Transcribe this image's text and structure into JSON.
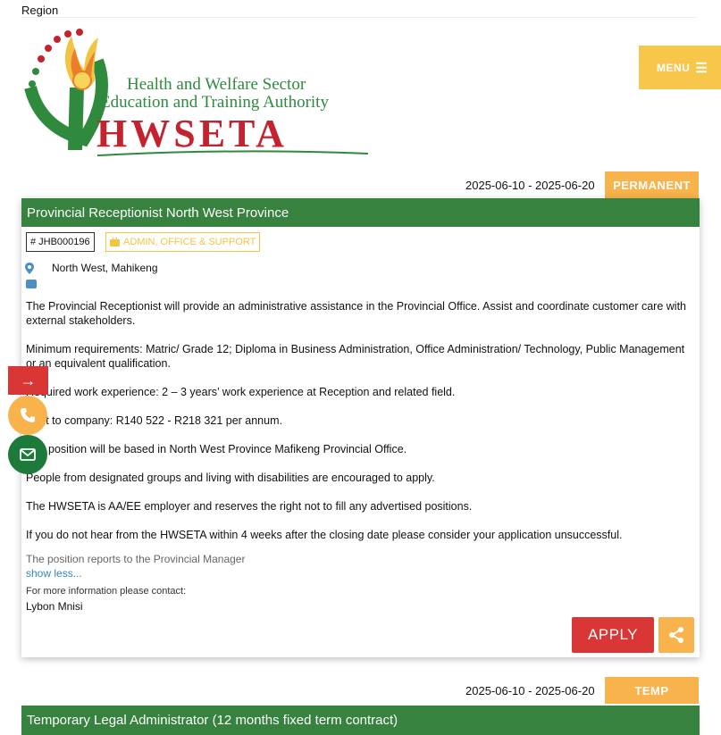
{
  "header": {
    "region_label": "Region",
    "menu_label": "MENU",
    "menu_icon": "hamburger-icon"
  },
  "logo": {
    "line1": "Health and Welfare Sector",
    "line2": "Education and Training Authority",
    "line3": "HWSETA"
  },
  "colors": {
    "header_green": "#36823e",
    "tag_orange": "#f8b34c",
    "menu_yellow": "#f8c64a",
    "apply_red": "#d93636",
    "mail_green": "#1d7a3b"
  },
  "jobs": [
    {
      "date_range": "2025-06-10 - 2025-06-20",
      "type": "PERMANENT",
      "title": "Provincial Receptionist North West Province",
      "ref": "JHB000196",
      "category": "ADMIN, OFFICE & SUPPORT",
      "location": "North West, Mahikeng",
      "description": [
        "The Provincial Receptionist will provide an administrative assistance in the Provincial Office. Assist and coordinate customer care with external stakeholders.",
        "Minimum requirements: Matric/ Grade 12; Diploma in Business Administration, Office Administration/ Technology, Public Management or an equivalent qualification.",
        "Required work experience:  2 – 3 years’ work experience at Reception and related field.",
        "Cost to company: R140 522 - R218 321 per annum.",
        "The position will be based in North West Province Mafikeng Provincial Office.",
        "People from designated groups and living with disabilities are encouraged to apply.",
        "The HWSETA is AA/EE employer and reserves the right not to fill any advertised positions.",
        "If you do not hear from the HWSETA within 4 weeks after the closing date please consider your application unsuccessful."
      ],
      "reports_to": "The position reports to the Provincial Manager",
      "show_less": "show less...",
      "more_info_label": "For more information please contact:",
      "contact_name": "Lybon Mnisi",
      "apply_label": "APPLY"
    },
    {
      "date_range": "2025-06-10 - 2025-06-20",
      "type": "TEMP",
      "title": "Temporary Legal Administrator (12 months fixed term contract)"
    }
  ],
  "floating": {
    "arrow_glyph": "→"
  }
}
